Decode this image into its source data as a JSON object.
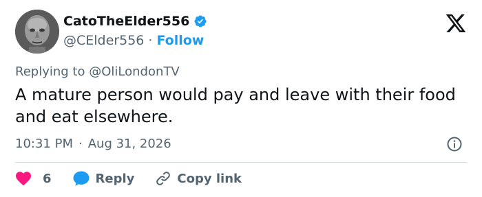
{
  "author": {
    "display_name": "CatoTheElder556",
    "handle": "@CElder556",
    "separator": "·",
    "follow_label": "Follow"
  },
  "reply": {
    "prefix": "Replying to",
    "mention": "@OliLondonTV"
  },
  "tweet": {
    "text": "A mature person would pay and leave with their food and eat elsewhere.",
    "time": "10:31 PM",
    "separator": "·",
    "date": "Aug 31, 2026"
  },
  "actions": {
    "like_count": "6",
    "reply_label": "Reply",
    "copy_link_label": "Copy link"
  },
  "colors": {
    "accent": "#1d9bf0",
    "like": "#f91880",
    "text": "#0f1419",
    "secondary": "#536471"
  },
  "icons": {
    "verified": "verified-badge-icon",
    "logo": "x-logo-icon",
    "info": "info-icon",
    "like": "heart-icon",
    "reply": "speech-bubble-icon",
    "copy_link": "link-icon"
  }
}
